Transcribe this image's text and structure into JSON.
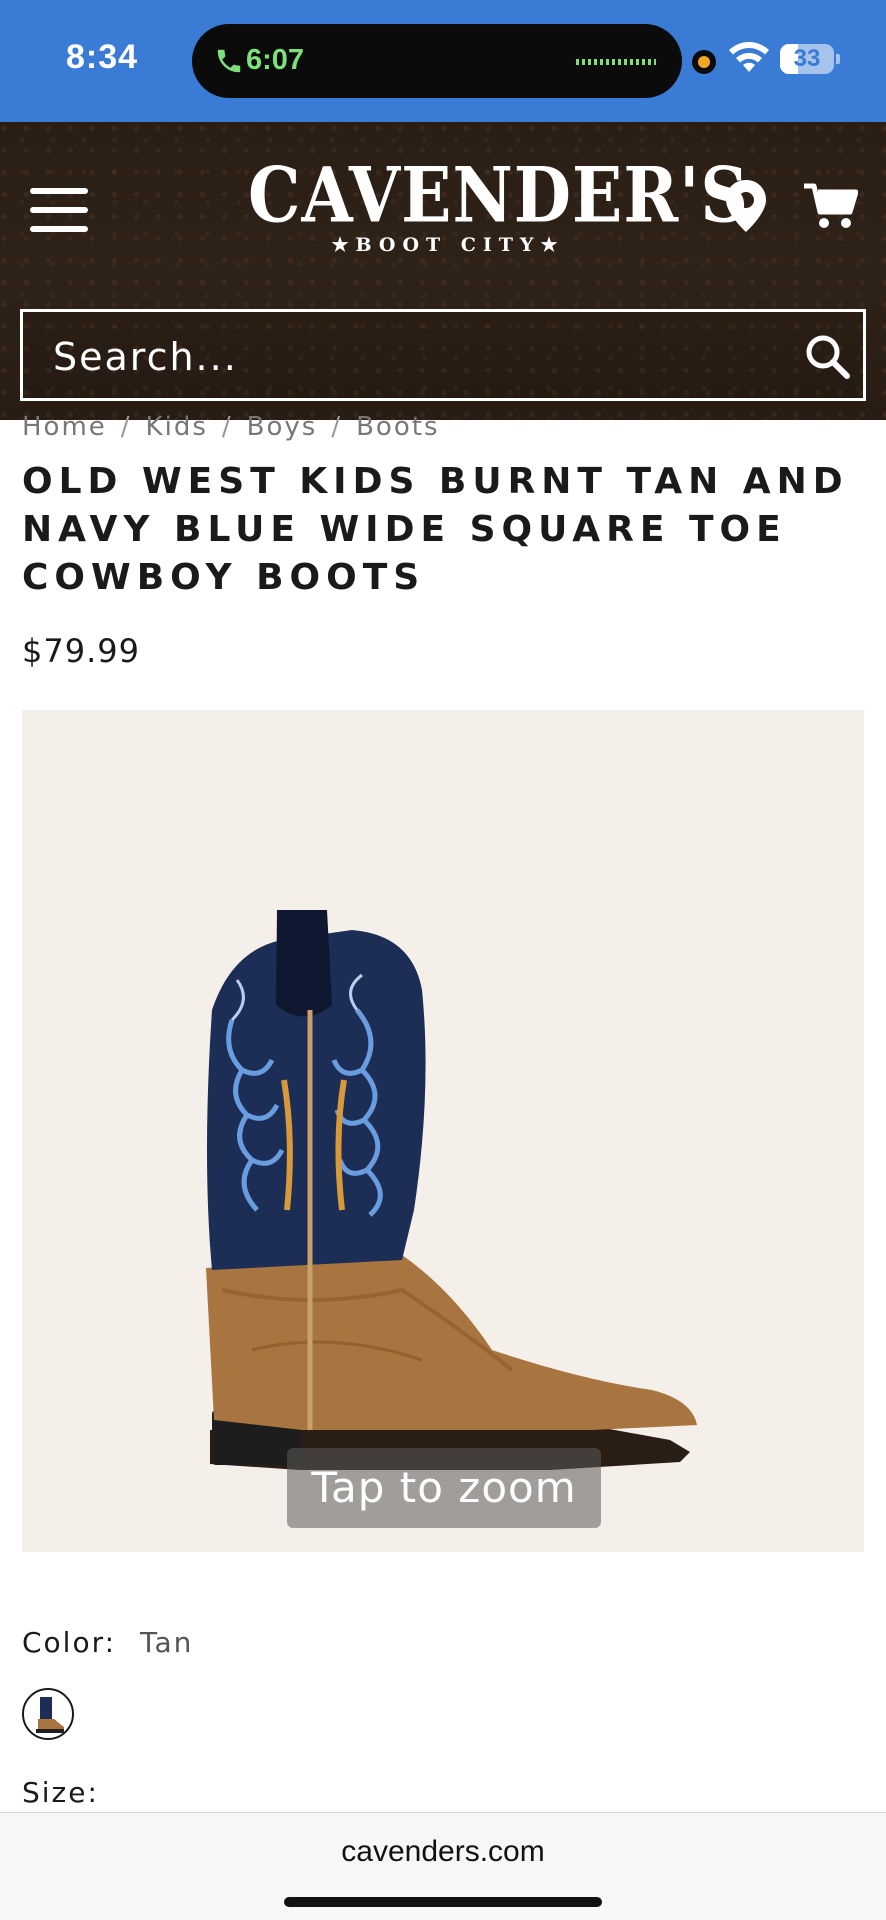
{
  "status_bar": {
    "time": "8:34",
    "call_time": "6:07",
    "battery": "33"
  },
  "header": {
    "logo_main": "CAVENDER'S",
    "logo_sub": "★BOOT CITY★",
    "search_placeholder": "Search..."
  },
  "breadcrumb": [
    "Home",
    "Kids",
    "Boys",
    "Boots"
  ],
  "product": {
    "title": "OLD WEST KIDS BURNT TAN AND NAVY BLUE WIDE SQUARE TOE COWBOY BOOTS",
    "price": "$79.99",
    "zoom_label": "Tap to zoom",
    "color_label": "Color:",
    "color_value": "Tan",
    "size_label": "Size:"
  },
  "browser": {
    "url": "cavenders.com"
  },
  "colors": {
    "status_bar": "#3a7bd5",
    "header_bg": "#2a1e15",
    "image_bg": "#f5efe9",
    "call_green": "#7ee07a"
  }
}
